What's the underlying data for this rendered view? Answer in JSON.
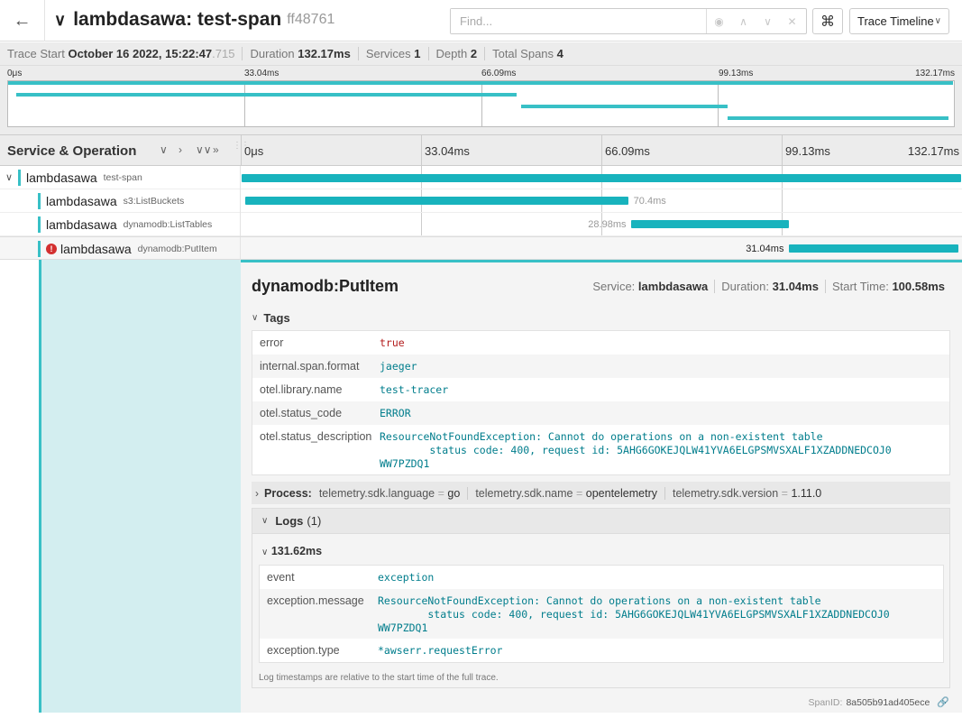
{
  "header": {
    "title": "lambdasawa: test-span",
    "trace_id": "ff48761",
    "search_placeholder": "Find...",
    "view": "Trace Timeline"
  },
  "summary": {
    "trace_start_label": "Trace Start",
    "trace_start": "October 16 2022, 15:22:47",
    "trace_start_ms": ".715",
    "duration_label": "Duration",
    "duration": "132.17ms",
    "services_label": "Services",
    "services": "1",
    "depth_label": "Depth",
    "depth": "2",
    "total_spans_label": "Total Spans",
    "total_spans": "4"
  },
  "ticks": [
    "0μs",
    "33.04ms",
    "66.09ms",
    "99.13ms",
    "132.17ms"
  ],
  "timeline": {
    "column_title": "Service & Operation",
    "total_ms": 132.17
  },
  "spans": [
    {
      "service": "lambdasawa",
      "operation": "test-span",
      "start_ms": 0,
      "duration_ms": 132.17,
      "label": "",
      "depth": 0,
      "error": false
    },
    {
      "service": "lambdasawa",
      "operation": "s3:ListBuckets",
      "start_ms": 0.6,
      "duration_ms": 70.4,
      "label": "70.4ms",
      "depth": 1,
      "error": false
    },
    {
      "service": "lambdasawa",
      "operation": "dynamodb:ListTables",
      "start_ms": 71.6,
      "duration_ms": 28.98,
      "label": "28.98ms",
      "depth": 1,
      "error": false
    },
    {
      "service": "lambdasawa",
      "operation": "dynamodb:PutItem",
      "start_ms": 100.58,
      "duration_ms": 31.04,
      "label": "31.04ms",
      "depth": 1,
      "error": true
    }
  ],
  "detail": {
    "title": "dynamodb:PutItem",
    "service_label": "Service:",
    "service": "lambdasawa",
    "duration_label": "Duration:",
    "duration": "31.04ms",
    "start_label": "Start Time:",
    "start": "100.58ms",
    "tags_label": "Tags",
    "tags": [
      {
        "key": "error",
        "value": "true",
        "error": true
      },
      {
        "key": "internal.span.format",
        "value": "jaeger"
      },
      {
        "key": "otel.library.name",
        "value": "test-tracer"
      },
      {
        "key": "otel.status_code",
        "value": "ERROR"
      },
      {
        "key": "otel.status_description",
        "value": "ResourceNotFoundException: Cannot do operations on a non-existent table\n        status code: 400, request id: 5AHG6GOKEJQLW41YVA6ELGPSMVSXALF1XZADDNEDCOJ0\nWW7PZDQ1"
      }
    ],
    "process_label": "Process:",
    "process": [
      {
        "key": "telemetry.sdk.language",
        "value": "go"
      },
      {
        "key": "telemetry.sdk.name",
        "value": "opentelemetry"
      },
      {
        "key": "telemetry.sdk.version",
        "value": "1.11.0"
      }
    ],
    "logs_label": "Logs",
    "logs_count": "(1)",
    "log_ts": "131.62ms",
    "log_fields": [
      {
        "key": "event",
        "value": "exception"
      },
      {
        "key": "exception.message",
        "value": "ResourceNotFoundException: Cannot do operations on a non-existent table\n        status code: 400, request id: 5AHG6GOKEJQLW41YVA6ELGPSMVSXALF1XZADDNEDCOJ0\nWW7PZDQ1"
      },
      {
        "key": "exception.type",
        "value": "*awserr.requestError"
      }
    ],
    "log_note": "Log timestamps are relative to the start time of the full trace.",
    "span_id_label": "SpanID:",
    "span_id": "8a505b91ad405ece"
  },
  "colors": {
    "accent": "#38c0c6",
    "bar": "#18b3bd",
    "error": "#d32f2f"
  }
}
